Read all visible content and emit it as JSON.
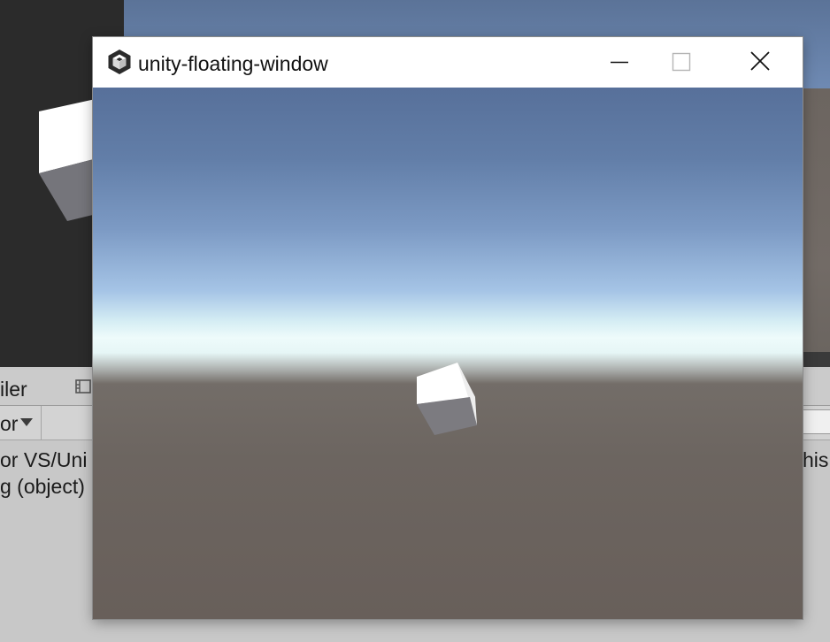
{
  "window": {
    "title": "unity-floating-window",
    "icon": "unity-logo-icon",
    "controls": [
      "minimize-icon",
      "maximize-icon",
      "close-icon"
    ]
  },
  "editor": {
    "tab_label": "iler",
    "tab_icon": "film-clip-icon",
    "dropdown_label": "or",
    "console_lines": [
      "or VS/Uni",
      "g (object)"
    ],
    "console_right_fragment": "his"
  },
  "colors": {
    "sky_top": "#57709a",
    "horizon": "#eefbfb",
    "ground": "#6c6560",
    "editor_dark": "#2b2b2b",
    "editor_light": "#c8c8c8"
  }
}
